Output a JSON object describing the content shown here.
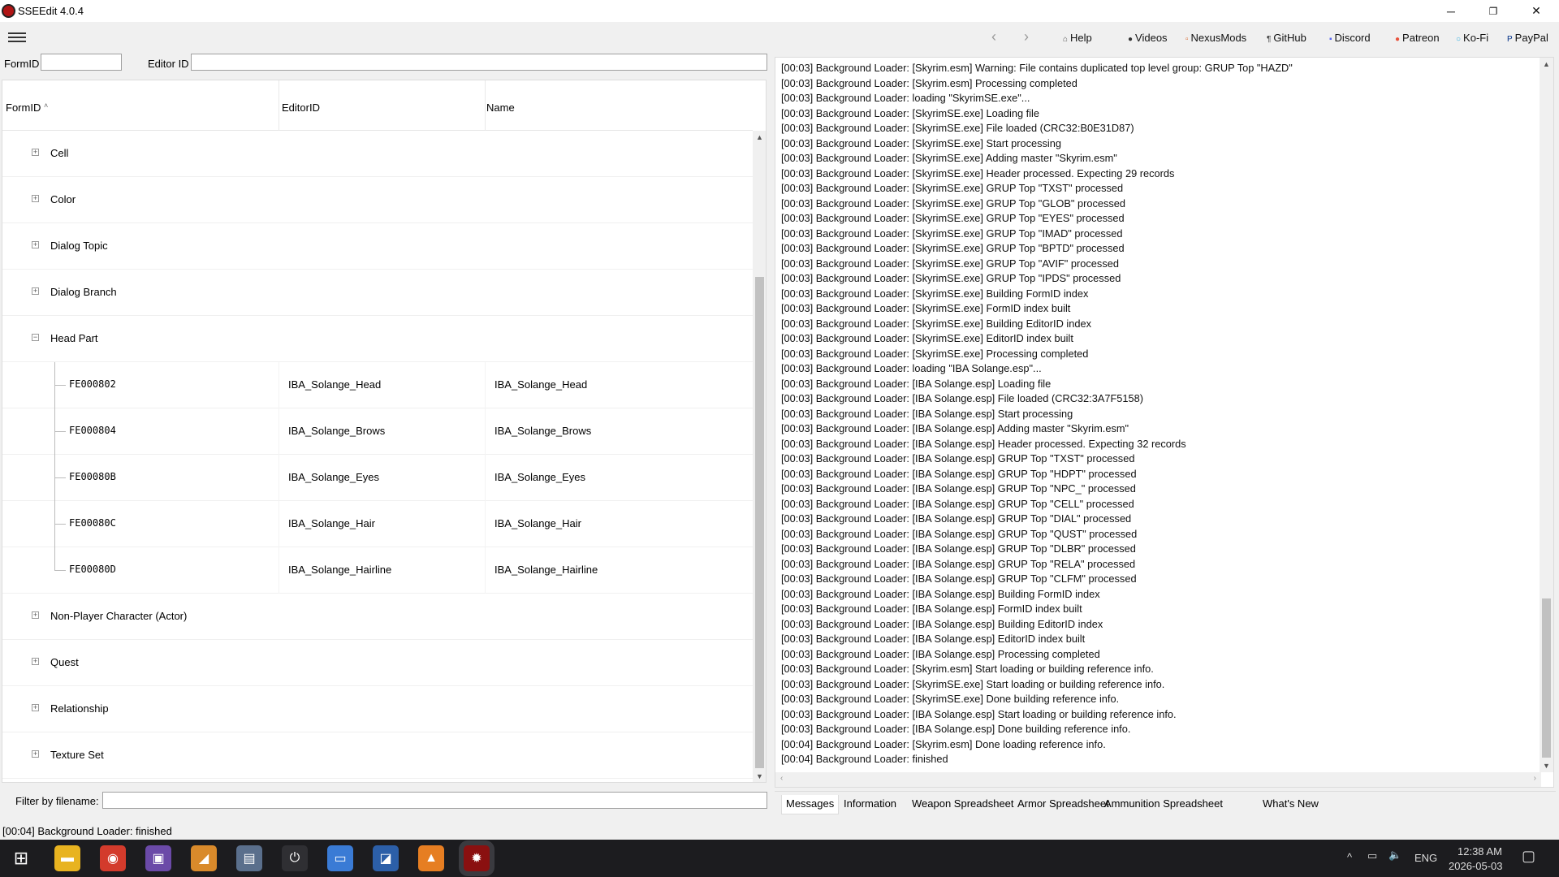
{
  "window": {
    "title": "SSEEdit 4.0.4",
    "min": "─",
    "restore": "❐",
    "close": "✕"
  },
  "toolbar": {
    "back": "‹",
    "forward": "›",
    "links": [
      {
        "label": "Help",
        "icon": "help-icon",
        "glyph": "⌂"
      },
      {
        "label": "Videos",
        "icon": "videos-icon",
        "glyph": "●"
      },
      {
        "label": "NexusMods",
        "icon": "nexusmods-icon",
        "glyph": "▫"
      },
      {
        "label": "GitHub",
        "icon": "github-icon",
        "glyph": "¶"
      },
      {
        "label": "Discord",
        "icon": "discord-icon",
        "glyph": "▪"
      },
      {
        "label": "Patreon",
        "icon": "patreon-icon",
        "glyph": "●"
      },
      {
        "label": "Ko-Fi",
        "icon": "kofi-icon",
        "glyph": "○"
      },
      {
        "label": "PayPal",
        "icon": "paypal-icon",
        "glyph": "P"
      }
    ]
  },
  "search": {
    "formid_label": "FormID",
    "editorid_label": "Editor ID",
    "formid_value": "",
    "editorid_value": ""
  },
  "tree": {
    "columns": [
      "FormID",
      "EditorID",
      "Name"
    ],
    "sort_indicator": "˄",
    "groups_before": [
      {
        "label": "Cell"
      },
      {
        "label": "Color"
      },
      {
        "label": "Dialog Topic"
      },
      {
        "label": "Dialog Branch"
      }
    ],
    "expanded_group": {
      "label": "Head Part",
      "records": [
        {
          "formid": "FE000802",
          "editorid": "IBA_Solange_Head",
          "name": "IBA_Solange_Head"
        },
        {
          "formid": "FE000804",
          "editorid": "IBA_Solange_Brows",
          "name": "IBA_Solange_Brows"
        },
        {
          "formid": "FE00080B",
          "editorid": "IBA_Solange_Eyes",
          "name": "IBA_Solange_Eyes"
        },
        {
          "formid": "FE00080C",
          "editorid": "IBA_Solange_Hair",
          "name": "IBA_Solange_Hair"
        },
        {
          "formid": "FE00080D",
          "editorid": "IBA_Solange_Hairline",
          "name": "IBA_Solange_Hairline"
        }
      ]
    },
    "groups_after": [
      {
        "label": "Non-Player Character (Actor)"
      },
      {
        "label": "Quest"
      },
      {
        "label": "Relationship"
      },
      {
        "label": "Texture Set"
      }
    ]
  },
  "filter": {
    "label": "Filter by filename:",
    "value": ""
  },
  "log": [
    "[00:03] Background Loader: [Skyrim.esm] Warning: File contains duplicated top level group: GRUP Top \"HAZD\"",
    "[00:03] Background Loader: [Skyrim.esm] Processing completed",
    "[00:03] Background Loader: loading \"SkyrimSE.exe\"...",
    "[00:03] Background Loader: [SkyrimSE.exe] Loading file",
    "[00:03] Background Loader: [SkyrimSE.exe] File loaded (CRC32:B0E31D87)",
    "[00:03] Background Loader: [SkyrimSE.exe] Start processing",
    "[00:03] Background Loader: [SkyrimSE.exe] Adding master \"Skyrim.esm\"",
    "[00:03] Background Loader: [SkyrimSE.exe] Header processed. Expecting 29 records",
    "[00:03] Background Loader: [SkyrimSE.exe] GRUP Top \"TXST\" processed",
    "[00:03] Background Loader: [SkyrimSE.exe] GRUP Top \"GLOB\" processed",
    "[00:03] Background Loader: [SkyrimSE.exe] GRUP Top \"EYES\" processed",
    "[00:03] Background Loader: [SkyrimSE.exe] GRUP Top \"IMAD\" processed",
    "[00:03] Background Loader: [SkyrimSE.exe] GRUP Top \"BPTD\" processed",
    "[00:03] Background Loader: [SkyrimSE.exe] GRUP Top \"AVIF\" processed",
    "[00:03] Background Loader: [SkyrimSE.exe] GRUP Top \"IPDS\" processed",
    "[00:03] Background Loader: [SkyrimSE.exe] Building FormID index",
    "[00:03] Background Loader: [SkyrimSE.exe] FormID index built",
    "[00:03] Background Loader: [SkyrimSE.exe] Building EditorID index",
    "[00:03] Background Loader: [SkyrimSE.exe] EditorID index built",
    "[00:03] Background Loader: [SkyrimSE.exe] Processing completed",
    "[00:03] Background Loader: loading \"IBA Solange.esp\"...",
    "[00:03] Background Loader: [IBA Solange.esp] Loading file",
    "[00:03] Background Loader: [IBA Solange.esp] File loaded (CRC32:3A7F5158)",
    "[00:03] Background Loader: [IBA Solange.esp] Start processing",
    "[00:03] Background Loader: [IBA Solange.esp] Adding master \"Skyrim.esm\"",
    "[00:03] Background Loader: [IBA Solange.esp] Header processed. Expecting 32 records",
    "[00:03] Background Loader: [IBA Solange.esp] GRUP Top \"TXST\" processed",
    "[00:03] Background Loader: [IBA Solange.esp] GRUP Top \"HDPT\" processed",
    "[00:03] Background Loader: [IBA Solange.esp] GRUP Top \"NPC_\" processed",
    "[00:03] Background Loader: [IBA Solange.esp] GRUP Top \"CELL\" processed",
    "[00:03] Background Loader: [IBA Solange.esp] GRUP Top \"DIAL\" processed",
    "[00:03] Background Loader: [IBA Solange.esp] GRUP Top \"QUST\" processed",
    "[00:03] Background Loader: [IBA Solange.esp] GRUP Top \"DLBR\" processed",
    "[00:03] Background Loader: [IBA Solange.esp] GRUP Top \"RELA\" processed",
    "[00:03] Background Loader: [IBA Solange.esp] GRUP Top \"CLFM\" processed",
    "[00:03] Background Loader: [IBA Solange.esp] Building FormID index",
    "[00:03] Background Loader: [IBA Solange.esp] FormID index built",
    "[00:03] Background Loader: [IBA Solange.esp] Building EditorID index",
    "[00:03] Background Loader: [IBA Solange.esp] EditorID index built",
    "[00:03] Background Loader: [IBA Solange.esp] Processing completed",
    "[00:03] Background Loader: [Skyrim.esm] Start loading or building reference info.",
    "[00:03] Background Loader: [SkyrimSE.exe] Start loading or building reference info.",
    "[00:03] Background Loader: [SkyrimSE.exe] Done building reference info.",
    "[00:03] Background Loader: [IBA Solange.esp] Start loading or building reference info.",
    "[00:03] Background Loader: [IBA Solange.esp] Done building reference info.",
    "[00:04] Background Loader: [Skyrim.esm] Done loading reference info.",
    "[00:04] Background Loader: finished"
  ],
  "tabs": [
    "Messages",
    "Information",
    "Weapon Spreadsheet",
    "Armor Spreadsheet",
    "Ammunition Spreadsheet",
    "What's New"
  ],
  "status": "[00:04] Background Loader: finished",
  "taskbar": {
    "apps": [
      {
        "icon": "windows-start-icon",
        "glyph": "⊞",
        "color": "#1c1c1f"
      },
      {
        "icon": "file-explorer-icon",
        "glyph": "▬",
        "color": "#e8b320"
      },
      {
        "icon": "chrome-icon",
        "glyph": "◉",
        "color": "#d33b2c"
      },
      {
        "icon": "app-purple-icon",
        "glyph": "▣",
        "color": "#6b4aa8"
      },
      {
        "icon": "app-orange-icon",
        "glyph": "◢",
        "color": "#d98a2b"
      },
      {
        "icon": "archive-icon",
        "glyph": "▤",
        "color": "#5a6f8c"
      },
      {
        "icon": "power-icon",
        "glyph": "⏻",
        "color": "#2f2f33"
      },
      {
        "icon": "monitor-icon",
        "glyph": "▭",
        "color": "#3a7bd5"
      },
      {
        "icon": "image-editor-icon",
        "glyph": "◪",
        "color": "#2c5fa8"
      },
      {
        "icon": "vlc-icon",
        "glyph": "▲",
        "color": "#e67e22"
      },
      {
        "icon": "sseedit-icon",
        "glyph": "✹",
        "color": "#8a1010"
      }
    ],
    "tray": {
      "lang": "ENG",
      "time": "12:38 AM",
      "date": "2026-05-03",
      "chevron": "^",
      "network": "▭",
      "volume": "🔈",
      "notif": "▢"
    }
  }
}
